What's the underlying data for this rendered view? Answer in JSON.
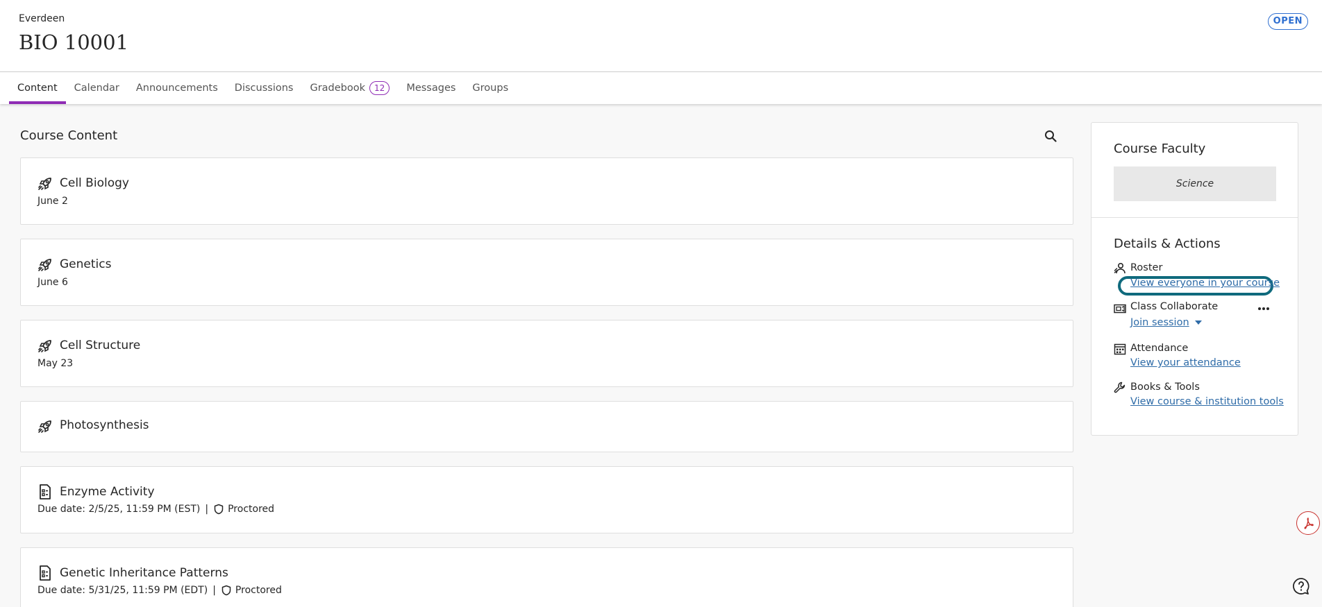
{
  "header": {
    "org": "Everdeen",
    "course_code": "BIO 10001",
    "status": "OPEN"
  },
  "tabs": [
    {
      "label": "Content",
      "active": true
    },
    {
      "label": "Calendar"
    },
    {
      "label": "Announcements"
    },
    {
      "label": "Discussions"
    },
    {
      "label": "Gradebook",
      "badge": "12"
    },
    {
      "label": "Messages"
    },
    {
      "label": "Groups"
    }
  ],
  "main": {
    "title": "Course Content",
    "search_icon": "search-icon",
    "items": [
      {
        "icon": "rocket-icon",
        "title": "Cell Biology",
        "subtitle": "June 2"
      },
      {
        "icon": "rocket-icon",
        "title": "Genetics",
        "subtitle": "June 6"
      },
      {
        "icon": "rocket-icon",
        "title": "Cell Structure",
        "subtitle": "May 23"
      },
      {
        "icon": "rocket-icon",
        "title": "Photosynthesis",
        "subtitle": ""
      },
      {
        "icon": "document-icon",
        "title": "Enzyme Activity",
        "due": "Due date: 2/5/25, 11:59 PM (EST)",
        "separator": "|",
        "proctored": "Proctored"
      },
      {
        "icon": "document-icon",
        "title": "Genetic Inheritance Patterns",
        "due": "Due date: 5/31/25, 11:59 PM (EDT)",
        "separator": "|",
        "proctored": "Proctored"
      }
    ]
  },
  "sidebar": {
    "faculty_title": "Course Faculty",
    "faculty_name": "Science",
    "details_title": "Details & Actions",
    "actions": [
      {
        "icon": "roster-icon",
        "label": "Roster",
        "link": "View everyone in your course",
        "focused": true
      },
      {
        "icon": "video-icon",
        "label": "Class Collaborate",
        "link": "Join session",
        "has_dropdown": true,
        "has_more": true
      },
      {
        "icon": "calendar-grid-icon",
        "label": "Attendance",
        "link": "View your attendance"
      },
      {
        "icon": "wrench-icon",
        "label": "Books & Tools",
        "link": "View course & institution tools"
      }
    ]
  },
  "floating": {
    "pdf_icon": "pdf-icon",
    "help_icon": "help-icon"
  },
  "colors": {
    "accent_purple": "#8f2cb5",
    "link_blue": "#2f6ca8",
    "badge_blue": "#2f6fd0",
    "focus_teal": "#0f6a7d",
    "pdf_red": "#c8302c"
  }
}
